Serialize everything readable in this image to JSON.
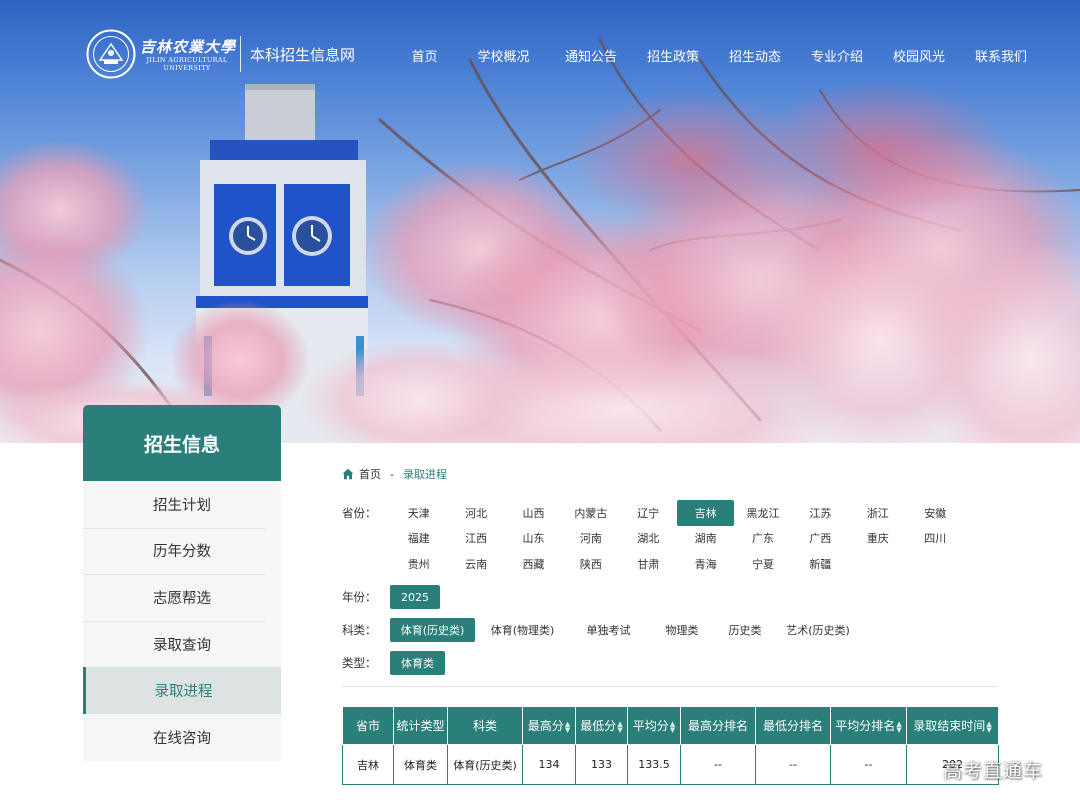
{
  "header": {
    "logo_cn": "吉林农業大學",
    "logo_en_line1": "JILIN AGRICULTURAL",
    "logo_en_line2": "UNIVERSITY",
    "site_name": "本科招生信息网",
    "nav": [
      "首页",
      "学校概况",
      "通知公告",
      "招生政策",
      "招生动态",
      "专业介绍",
      "校园风光",
      "联系我们"
    ]
  },
  "sidebar": {
    "title": "招生信息",
    "items": [
      "招生计划",
      "历年分数",
      "志愿帮选",
      "录取查询",
      "录取进程",
      "在线咨询"
    ],
    "active_index": 4
  },
  "breadcrumb": {
    "home": "首页",
    "separator": "-",
    "current": "录取进程"
  },
  "filters": {
    "province_label": "省份：",
    "provinces": [
      "天津",
      "河北",
      "山西",
      "内蒙古",
      "辽宁",
      "吉林",
      "黑龙江",
      "江苏",
      "浙江",
      "安徽",
      "福建",
      "江西",
      "山东",
      "河南",
      "湖北",
      "湖南",
      "广东",
      "广西",
      "重庆",
      "四川",
      "贵州",
      "云南",
      "西藏",
      "陕西",
      "甘肃",
      "青海",
      "宁夏",
      "新疆"
    ],
    "selected_province": "吉林",
    "year_label": "年份：",
    "year": "2025",
    "subject_label": "科类：",
    "subjects": [
      "体育(历史类)",
      "体育(物理类)",
      "单独考试",
      "物理类",
      "历史类",
      "艺术(历史类)"
    ],
    "selected_subject": "体育(历史类)",
    "type_label": "类型：",
    "type": "体育类"
  },
  "table": {
    "columns": [
      "省市",
      "统计类型",
      "科类",
      "最高分",
      "最低分",
      "平均分",
      "最高分排名",
      "最低分排名",
      "平均分排名",
      "录取结束时间"
    ],
    "sortable": [
      false,
      false,
      false,
      true,
      true,
      true,
      false,
      false,
      true,
      true
    ],
    "rows": [
      [
        "吉林",
        "体育类",
        "体育(历史类)",
        "134",
        "133",
        "133.5",
        "--",
        "--",
        "--",
        "202"
      ]
    ]
  },
  "watermark": "高考直通车",
  "colors": {
    "accent": "#2a7f7b",
    "sidebar_bg": "#f6f6f6",
    "sky_top": "#2e63c4"
  },
  "icons": {
    "home": "home-icon",
    "sort": "sort-icon",
    "emblem": "university-emblem-icon"
  }
}
